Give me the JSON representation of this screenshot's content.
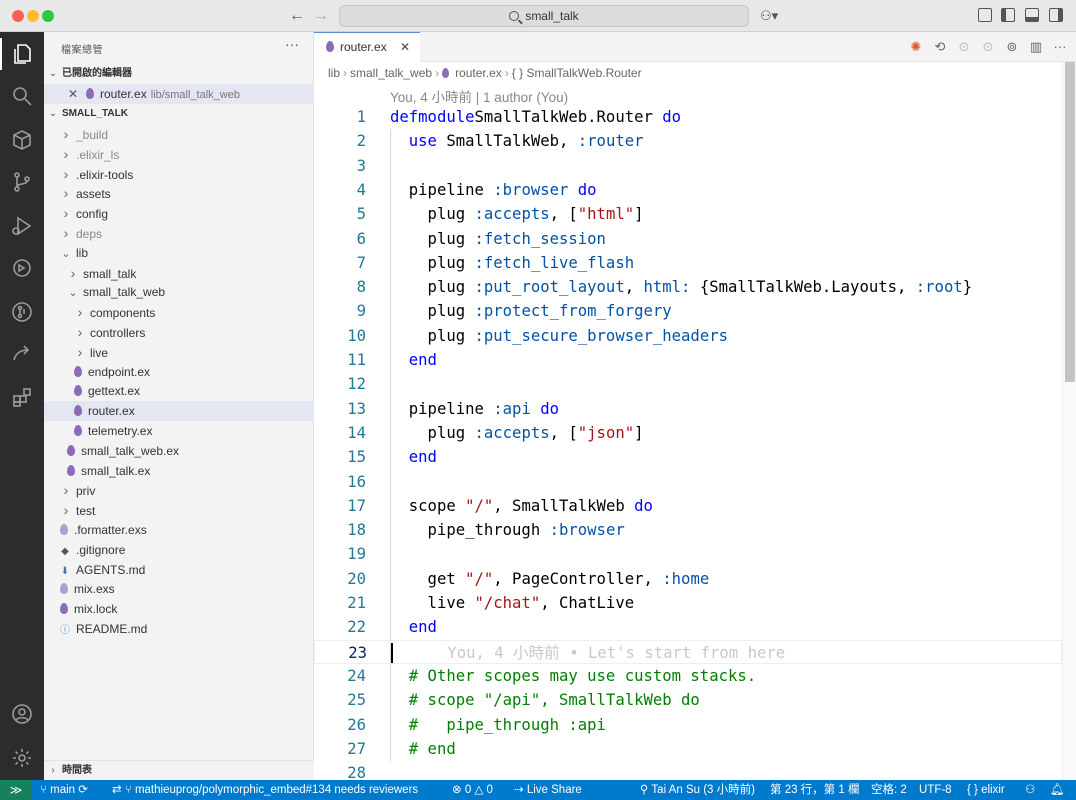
{
  "titlebar": {
    "search_label": "small_talk"
  },
  "sidebar": {
    "title": "檔案總管",
    "open_editors_header": "已開啟的編輯器",
    "open_editor": {
      "name": "router.ex",
      "path": "lib/small_talk_web"
    },
    "project_header": "SMALL_TALK",
    "tree": [
      {
        "label": "_build",
        "kind": "folder",
        "depth": 0,
        "muted": true
      },
      {
        "label": ".elixir_ls",
        "kind": "folder",
        "depth": 0,
        "muted": true
      },
      {
        "label": ".elixir-tools",
        "kind": "folder",
        "depth": 0
      },
      {
        "label": "assets",
        "kind": "folder",
        "depth": 0
      },
      {
        "label": "config",
        "kind": "folder",
        "depth": 0
      },
      {
        "label": "deps",
        "kind": "folder",
        "depth": 0,
        "muted": true
      },
      {
        "label": "lib",
        "kind": "folder-open",
        "depth": 0
      },
      {
        "label": "small_talk",
        "kind": "folder",
        "depth": 1
      },
      {
        "label": "small_talk_web",
        "kind": "folder-open",
        "depth": 1
      },
      {
        "label": "components",
        "kind": "folder",
        "depth": 2
      },
      {
        "label": "controllers",
        "kind": "folder",
        "depth": 2
      },
      {
        "label": "live",
        "kind": "folder",
        "depth": 2
      },
      {
        "label": "endpoint.ex",
        "kind": "elixir",
        "depth": 2
      },
      {
        "label": "gettext.ex",
        "kind": "elixir",
        "depth": 2
      },
      {
        "label": "router.ex",
        "kind": "elixir",
        "depth": 2,
        "selected": true
      },
      {
        "label": "telemetry.ex",
        "kind": "elixir",
        "depth": 2
      },
      {
        "label": "small_talk_web.ex",
        "kind": "elixir",
        "depth": 1
      },
      {
        "label": "small_talk.ex",
        "kind": "elixir",
        "depth": 1
      },
      {
        "label": "priv",
        "kind": "folder",
        "depth": 0
      },
      {
        "label": "test",
        "kind": "folder",
        "depth": 0
      },
      {
        "label": ".formatter.exs",
        "kind": "elixir-light",
        "depth": 0
      },
      {
        "label": ".gitignore",
        "kind": "git",
        "depth": 0
      },
      {
        "label": "AGENTS.md",
        "kind": "md-down",
        "depth": 0
      },
      {
        "label": "mix.exs",
        "kind": "elixir-light",
        "depth": 0
      },
      {
        "label": "mix.lock",
        "kind": "elixir",
        "depth": 0
      },
      {
        "label": "README.md",
        "kind": "info",
        "depth": 0
      }
    ],
    "timeline_header": "時間表"
  },
  "editor": {
    "tab_label": "router.ex",
    "breadcrumb": [
      "lib",
      "small_talk_web",
      "router.ex",
      "{ } SmallTalkWeb.Router"
    ],
    "blame_top": "You, 4 小時前 | 1 author (You)",
    "current_line": 23,
    "lines": [
      [
        [
          "k",
          "defmodule"
        ],
        [
          "",
          "SmallTalkWeb.Router "
        ],
        [
          "k",
          "do"
        ]
      ],
      [
        [
          "",
          "  "
        ],
        [
          "k",
          "use"
        ],
        [
          "",
          "SmallTalkWeb, "
        ],
        [
          "a",
          ":router"
        ]
      ],
      [],
      [
        [
          "",
          "  pipeline "
        ],
        [
          "a",
          ":browser"
        ],
        [
          "",
          ""
        ],
        [
          "k",
          " do"
        ]
      ],
      [
        [
          "",
          "    plug "
        ],
        [
          "a",
          ":accepts"
        ],
        [
          "",
          ", ["
        ],
        [
          "s",
          "\"html\""
        ],
        [
          "",
          "]"
        ]
      ],
      [
        [
          "",
          "    plug "
        ],
        [
          "a",
          ":fetch_session"
        ]
      ],
      [
        [
          "",
          "    plug "
        ],
        [
          "a",
          ":fetch_live_flash"
        ]
      ],
      [
        [
          "",
          "    plug "
        ],
        [
          "a",
          ":put_root_layout"
        ],
        [
          "",
          ", "
        ],
        [
          "a",
          "html:"
        ],
        [
          "",
          " {SmallTalkWeb.Layouts, "
        ],
        [
          "a",
          ":root"
        ],
        [
          "",
          "}"
        ]
      ],
      [
        [
          "",
          "    plug "
        ],
        [
          "a",
          ":protect_from_forgery"
        ]
      ],
      [
        [
          "",
          "    plug "
        ],
        [
          "a",
          ":put_secure_browser_headers"
        ]
      ],
      [
        [
          "",
          "  "
        ],
        [
          "k",
          "end"
        ]
      ],
      [],
      [
        [
          "",
          "  pipeline "
        ],
        [
          "a",
          ":api"
        ],
        [
          "k",
          " do"
        ]
      ],
      [
        [
          "",
          "    plug "
        ],
        [
          "a",
          ":accepts"
        ],
        [
          "",
          ", ["
        ],
        [
          "s",
          "\"json\""
        ],
        [
          "",
          "]"
        ]
      ],
      [
        [
          "",
          "  "
        ],
        [
          "k",
          "end"
        ]
      ],
      [],
      [
        [
          "",
          "  scope "
        ],
        [
          "s",
          "\"/\""
        ],
        [
          "",
          ", SmallTalkWeb "
        ],
        [
          "k",
          "do"
        ]
      ],
      [
        [
          "",
          "    pipe_through "
        ],
        [
          "a",
          ":browser"
        ]
      ],
      [],
      [
        [
          "",
          "    get "
        ],
        [
          "s",
          "\"/\""
        ],
        [
          "",
          ", PageController, "
        ],
        [
          "a",
          ":home"
        ]
      ],
      [
        [
          "",
          "    live "
        ],
        [
          "s",
          "\"/chat\""
        ],
        [
          "",
          ", ChatLive"
        ]
      ],
      [
        [
          "",
          "  "
        ],
        [
          "k",
          "end"
        ]
      ],
      [
        [
          "ghost",
          "      You, 4 小時前 • Let's start from here"
        ]
      ],
      [
        [
          "c",
          "  # Other scopes may use custom stacks."
        ]
      ],
      [
        [
          "c",
          "  # scope \"/api\", SmallTalkWeb do"
        ]
      ],
      [
        [
          "c",
          "  #   pipe_through :api"
        ]
      ],
      [
        [
          "c",
          "  # end"
        ]
      ],
      []
    ]
  },
  "statusbar": {
    "branch": "main",
    "pr": "mathieuprog/polymorphic_embed#134 needs reviewers",
    "errors": "0",
    "warnings": "0",
    "live_share": "Live Share",
    "blame": "Tai An Su (3 小時前)",
    "position": "第 23 行，第 1 欄",
    "spaces": "空格: 2",
    "encoding": "UTF-8",
    "language": "elixir"
  }
}
